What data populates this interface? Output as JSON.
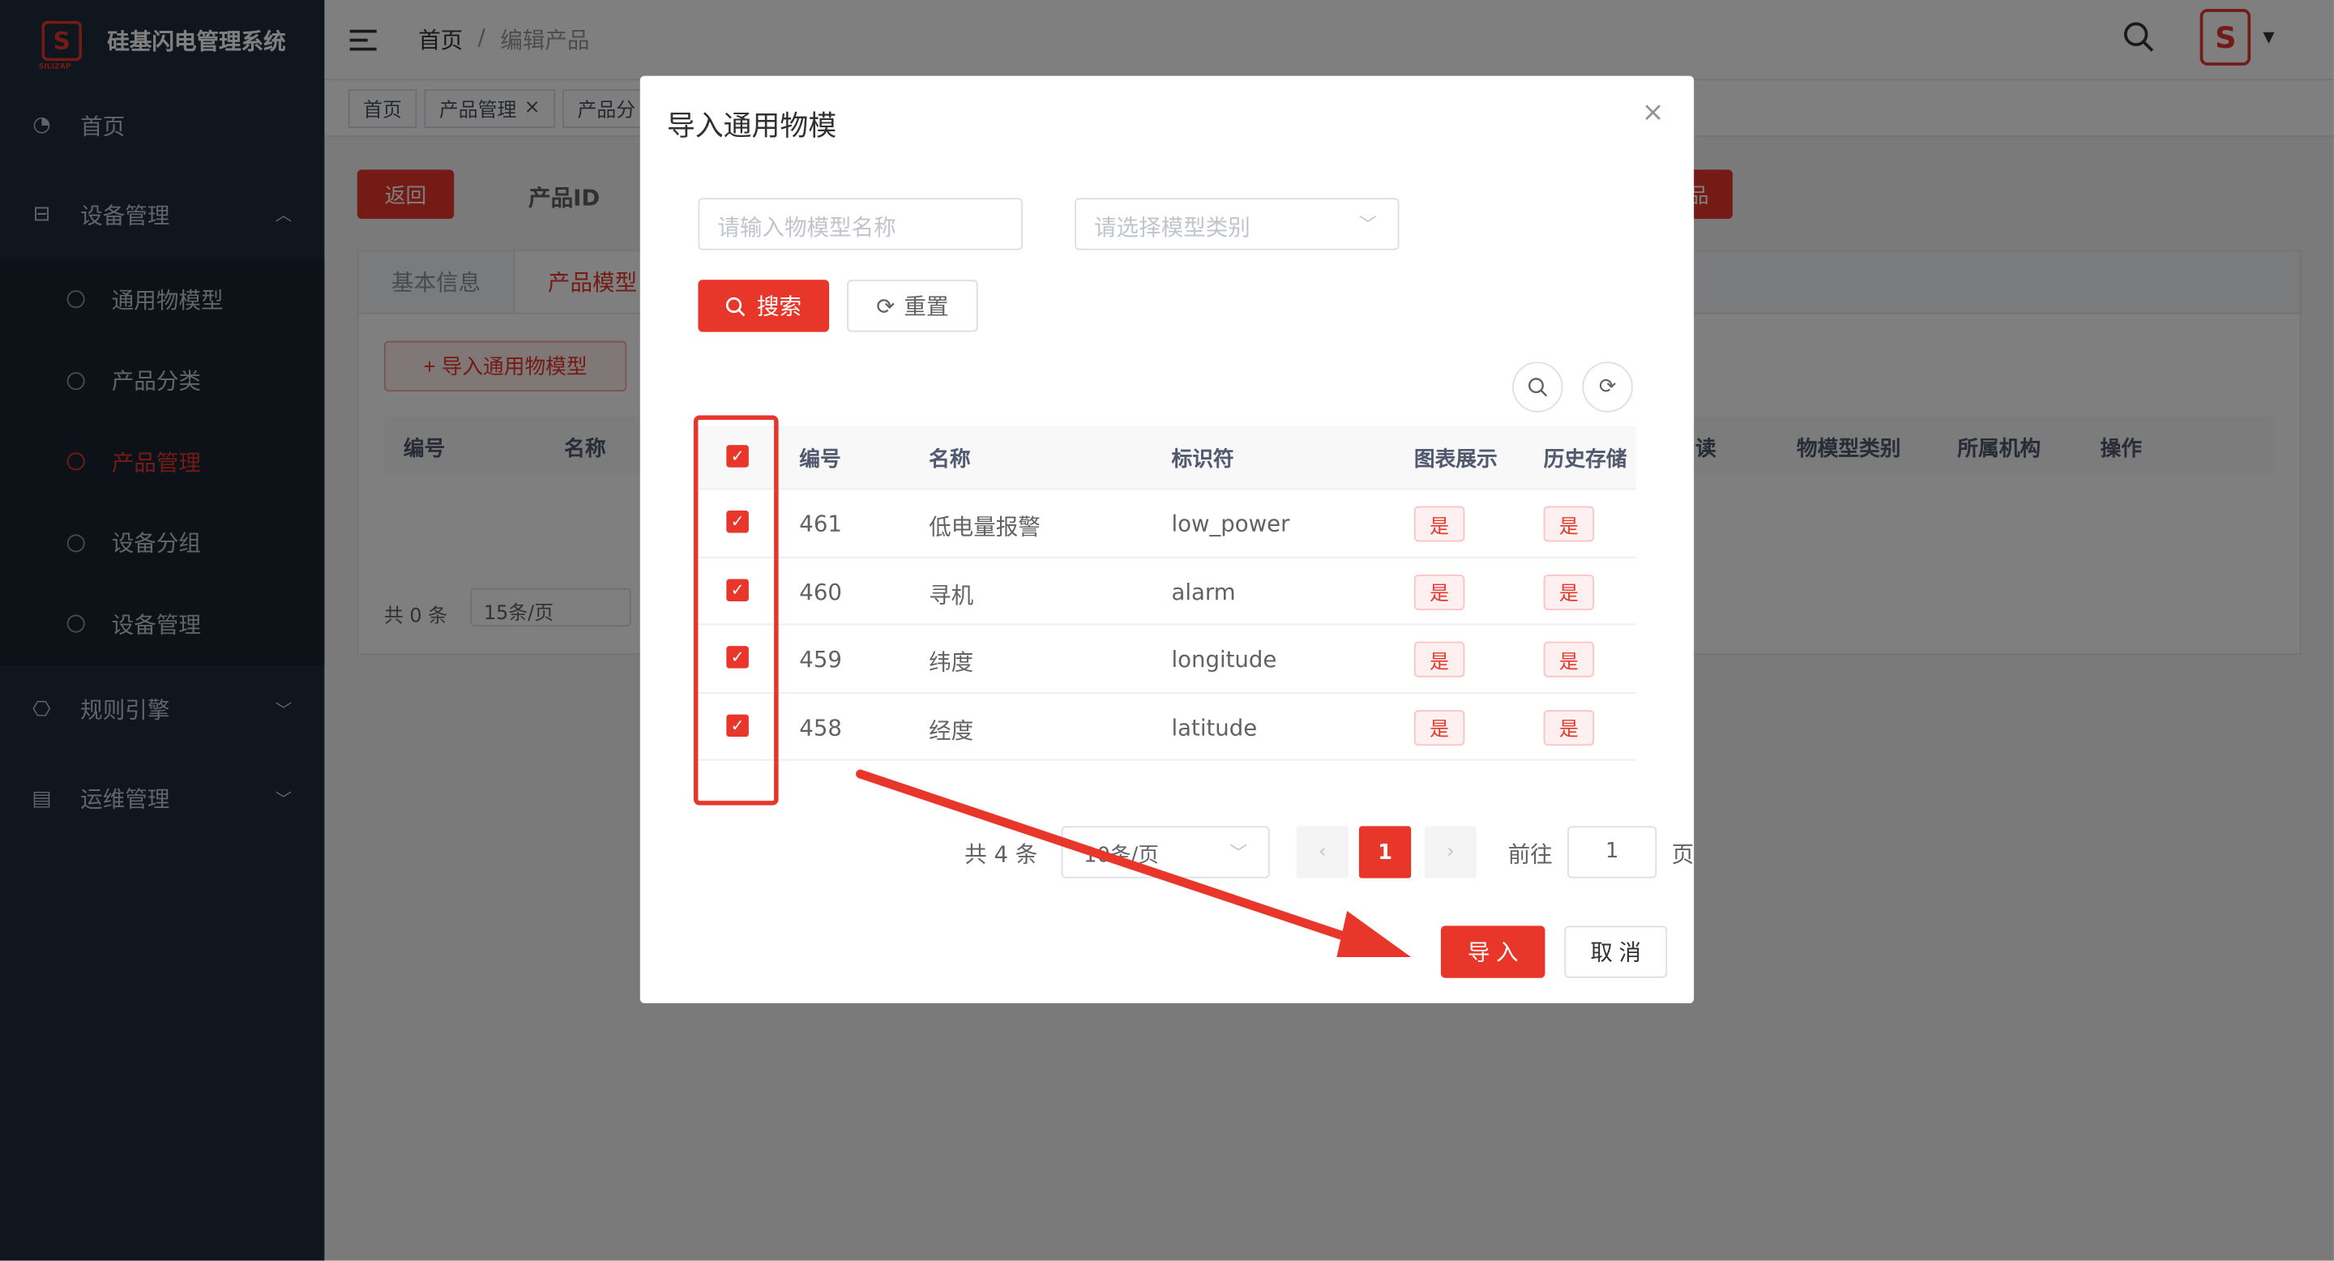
{
  "app": {
    "title": "硅基闪电管理系统",
    "logo_text": "SILIZAP"
  },
  "sidebar": {
    "items": [
      {
        "label": "首页",
        "icon": "dashboard-icon"
      },
      {
        "label": "设备管理",
        "icon": "device-icon",
        "expanded": true
      },
      {
        "label": "规则引擎",
        "icon": "rule-icon"
      },
      {
        "label": "运维管理",
        "icon": "ops-icon"
      }
    ],
    "sub_items": [
      {
        "label": "通用物模型"
      },
      {
        "label": "产品分类"
      },
      {
        "label": "产品管理",
        "active": true
      },
      {
        "label": "设备分组"
      },
      {
        "label": "设备管理"
      }
    ]
  },
  "breadcrumb": {
    "home": "首页",
    "sep": "/",
    "current": "编辑产品"
  },
  "tags": [
    {
      "label": "首页"
    },
    {
      "label": "产品管理",
      "close": "×"
    },
    {
      "label": "产品分"
    }
  ],
  "main": {
    "back_label": "返回",
    "product_id_label": "产品ID",
    "right_btn_label": "品",
    "tabs": [
      "基本信息",
      "产品模型"
    ],
    "import_label": "+ 导入通用物模型",
    "headers": [
      "编号",
      "名称",
      "读",
      "物模型类别",
      "所属机构",
      "操作"
    ],
    "total": "共 0 条",
    "page_size": "15条/页"
  },
  "dialog": {
    "title": "导入通用物模",
    "close_icon": "×",
    "name_placeholder": "请输入物模型名称",
    "type_placeholder": "请选择模型类别",
    "search_label": "搜索",
    "reset_label": "重置",
    "columns": [
      "编号",
      "名称",
      "标识符",
      "图表展示",
      "历史存储"
    ],
    "rows": [
      {
        "id": "461",
        "name": "低电量报警",
        "identifier": "low_power",
        "chart": "是",
        "history": "是"
      },
      {
        "id": "460",
        "name": "寻机",
        "identifier": "alarm",
        "chart": "是",
        "history": "是"
      },
      {
        "id": "459",
        "name": "纬度",
        "identifier": "longitude",
        "chart": "是",
        "history": "是"
      },
      {
        "id": "458",
        "name": "经度",
        "identifier": "latitude",
        "chart": "是",
        "history": "是"
      }
    ],
    "pager": {
      "total": "共 4 条",
      "size": "10条/页",
      "current": "1",
      "goto_label": "前往",
      "goto_value": "1",
      "page_suffix": "页"
    },
    "ok_label": "导 入",
    "cancel_label": "取 消"
  },
  "accent_color": "#e8372a"
}
